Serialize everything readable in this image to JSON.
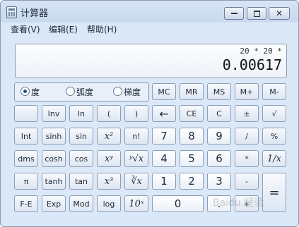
{
  "window": {
    "title": "计算器"
  },
  "menu": [
    {
      "label": "查看(V)"
    },
    {
      "label": "编辑(E)"
    },
    {
      "label": "帮助(H)"
    }
  ],
  "display": {
    "expression": "20 * 20 *",
    "value": "0.00617"
  },
  "angle": {
    "options": [
      {
        "label": "度",
        "selected": true
      },
      {
        "label": "弧度",
        "selected": false
      },
      {
        "label": "梯度",
        "selected": false
      }
    ]
  },
  "memory": [
    {
      "label": "MC"
    },
    {
      "label": "MR"
    },
    {
      "label": "MS"
    },
    {
      "label": "M+"
    },
    {
      "label": "M-"
    }
  ],
  "keys": {
    "r1": [
      "",
      "Inv",
      "ln",
      "(",
      ")",
      "←",
      "CE",
      "C",
      "±",
      "√"
    ],
    "r2": [
      "Int",
      "sinh",
      "sin",
      "x²",
      "n!",
      "7",
      "8",
      "9",
      "/",
      "%"
    ],
    "r3": [
      "dms",
      "cosh",
      "cos",
      "xʸ",
      "ʸ√x",
      "4",
      "5",
      "6",
      "*",
      "1/x"
    ],
    "r4": [
      "π",
      "tanh",
      "tan",
      "x³",
      "∛x",
      "1",
      "2",
      "3",
      "-",
      "="
    ],
    "r5": [
      "F-E",
      "Exp",
      "Mod",
      "log",
      "10ˣ",
      "0",
      ".",
      "+"
    ]
  },
  "watermark": "Baidu 经验"
}
